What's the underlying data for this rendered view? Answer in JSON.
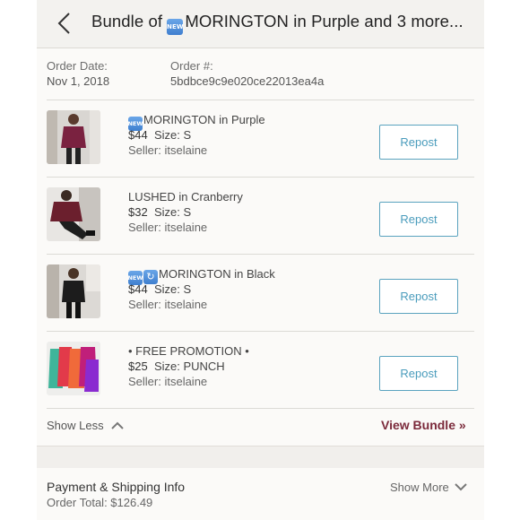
{
  "header": {
    "title_badge": "NEW",
    "title_text": "MORINGTON in Purple and 3 more...",
    "title_prefix": "Bundle of "
  },
  "order": {
    "date_label": "Order Date:",
    "date_value": "Nov 1, 2018",
    "number_label": "Order #:",
    "number_value": "5bdbce9c9e020ce22013ea4a"
  },
  "items": [
    {
      "badge": "NEW",
      "name": "MORINGTON in Purple",
      "price": "$44",
      "size": "Size: S",
      "seller": "Seller: itselaine",
      "action": "Repost"
    },
    {
      "badge": "",
      "name": "LUSHED in Cranberry",
      "price": "$32",
      "size": "Size: S",
      "seller": "Seller: itselaine",
      "action": "Repost"
    },
    {
      "badge": "NEW",
      "badge2": "↻",
      "name": "MORINGTON in Black",
      "price": "$44",
      "size": "Size: S",
      "seller": "Seller: itselaine",
      "action": "Repost"
    },
    {
      "badge": "",
      "name": "• FREE PROMOTION •",
      "price": "$25",
      "size": "Size: PUNCH",
      "seller": "Seller: itselaine",
      "action": "Repost"
    }
  ],
  "footer": {
    "show_less": "Show Less",
    "view_bundle": "View Bundle »"
  },
  "payment": {
    "title": "Payment & Shipping Info",
    "total": "Order Total: $126.49",
    "show_more": "Show More"
  },
  "colors": {
    "accent_repost": "#4a9cbc",
    "view_bundle": "#7b2a3b"
  }
}
